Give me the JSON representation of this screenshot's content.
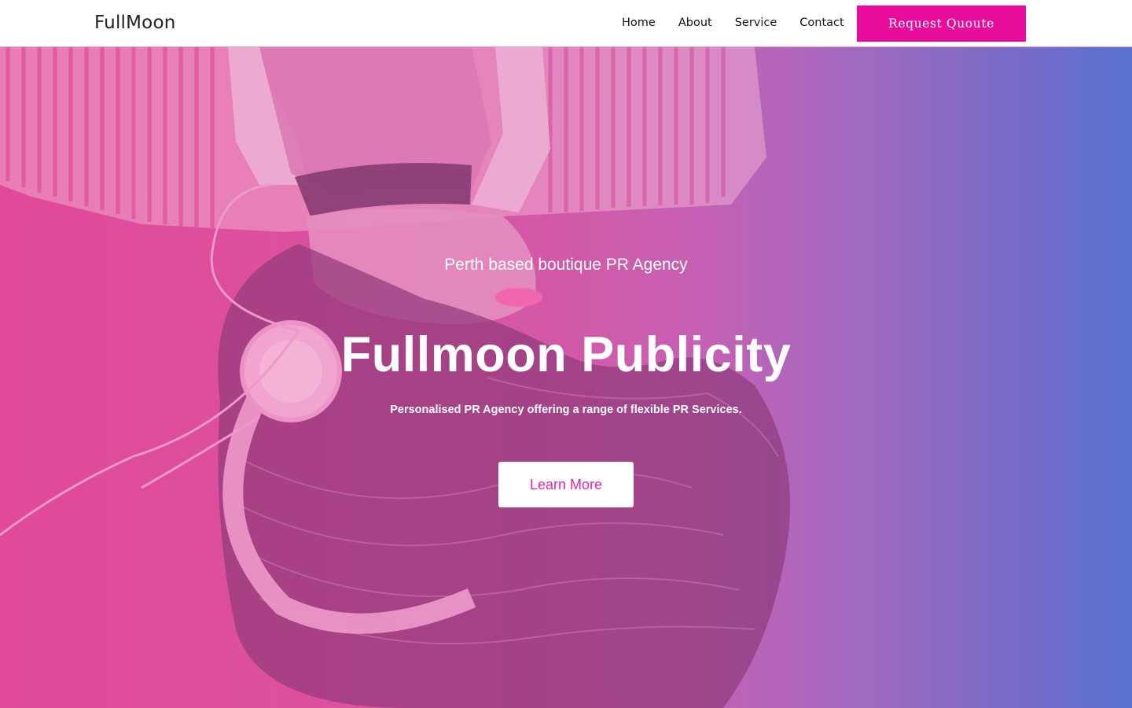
{
  "header": {
    "logo": "FullMoon",
    "nav": [
      "Home",
      "About",
      "Service",
      "Contact"
    ],
    "cta_label": "Request Quoute"
  },
  "hero": {
    "tagline": "Perth based boutique PR Agency",
    "title": "Fullmoon Publicity",
    "subtitle": "Personalised PR Agency offering a range of flexible PR Services.",
    "button_label": "Learn More",
    "image": "woman-with-headphones-upside-down"
  },
  "colors": {
    "accent": "#e80c9c",
    "gradient_left": "#e04a98",
    "gradient_right": "#5c74d0",
    "button_text": "#e323ae"
  }
}
